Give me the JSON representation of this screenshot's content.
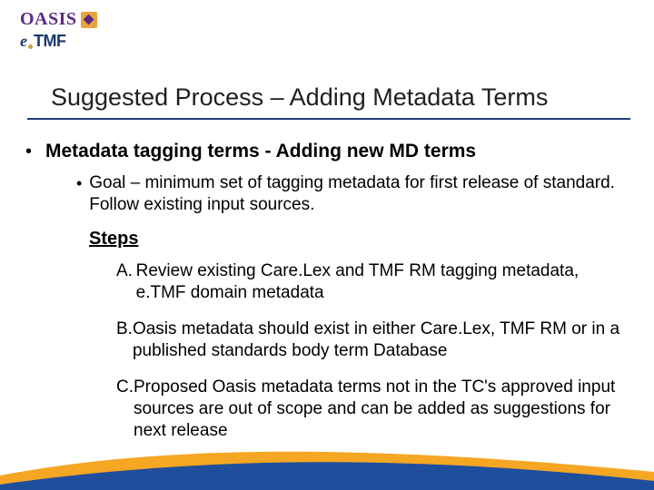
{
  "logo": {
    "oasis": "OASIS",
    "etmf_e": "e",
    "etmf_tmf": "TMF"
  },
  "title": "Suggested Process – Adding Metadata Terms",
  "bullet1": "Metadata tagging terms - Adding new MD terms",
  "sub_goal": "Goal – minimum set of tagging metadata for first release of standard.  Follow existing input sources.",
  "steps_heading": "Steps",
  "steps": [
    {
      "letter": "A.",
      "text": "Review existing Care.Lex and TMF RM tagging metadata, e.TMF domain metadata"
    },
    {
      "letter": "B.",
      "text": "Oasis metadata should exist in either Care.Lex, TMF RM or in a published standards body term Database"
    },
    {
      "letter": "C.",
      "text": "Proposed Oasis metadata terms not in the TC's approved input sources are out of scope and can be added as suggestions for next release"
    }
  ]
}
